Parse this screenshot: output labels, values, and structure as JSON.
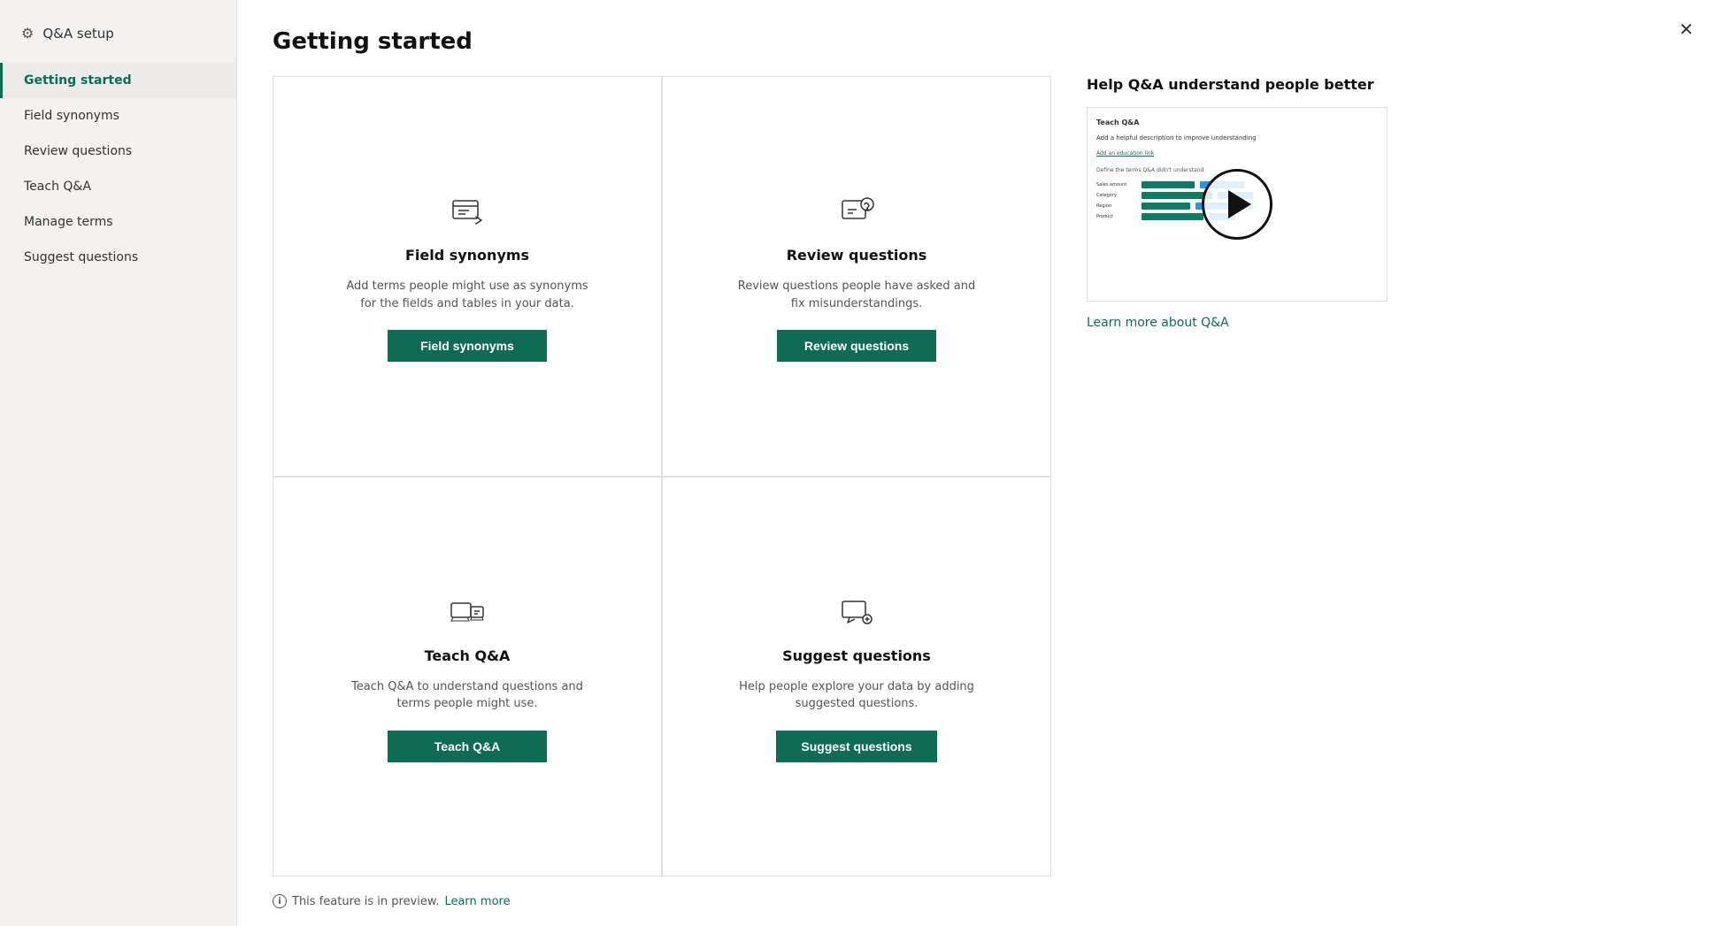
{
  "sidebar": {
    "header": {
      "icon": "⚙",
      "label": "Q&A setup"
    },
    "items": [
      {
        "id": "getting-started",
        "label": "Getting started",
        "active": true
      },
      {
        "id": "field-synonyms",
        "label": "Field synonyms",
        "active": false
      },
      {
        "id": "review-questions",
        "label": "Review questions",
        "active": false
      },
      {
        "id": "teach-qa",
        "label": "Teach Q&A",
        "active": false
      },
      {
        "id": "manage-terms",
        "label": "Manage terms",
        "active": false
      },
      {
        "id": "suggest-questions",
        "label": "Suggest questions",
        "active": false
      }
    ]
  },
  "main": {
    "title": "Getting started",
    "cards": [
      {
        "id": "field-synonyms",
        "title": "Field synonyms",
        "description": "Add terms people might use as synonyms for the fields and tables in your data.",
        "button_label": "Field synonyms"
      },
      {
        "id": "review-questions",
        "title": "Review questions",
        "description": "Review questions people have asked and fix misunderstandings.",
        "button_label": "Review questions"
      },
      {
        "id": "teach-qa",
        "title": "Teach Q&A",
        "description": "Teach Q&A to understand questions and terms people might use.",
        "button_label": "Teach Q&A"
      },
      {
        "id": "suggest-questions",
        "title": "Suggest questions",
        "description": "Help people explore your data by adding suggested questions.",
        "button_label": "Suggest questions"
      }
    ]
  },
  "right_panel": {
    "help_title": "Help Q&A understand people better",
    "learn_more_label": "Learn more about Q&A"
  },
  "footer": {
    "text": "This feature is in preview.",
    "learn_more_label": "Learn more"
  },
  "close_button_label": "✕"
}
